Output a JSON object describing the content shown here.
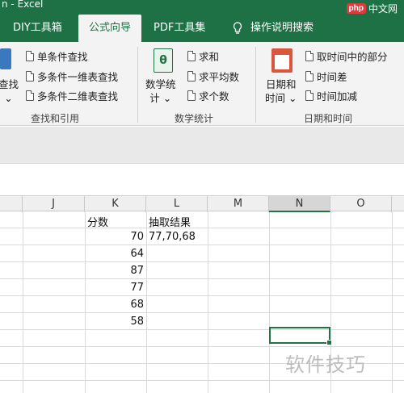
{
  "window": {
    "title_fragment": "n - Excel"
  },
  "brand": {
    "badge": "php",
    "text": "中文网"
  },
  "tabs": [
    {
      "label": "DIY工具箱"
    },
    {
      "label": "公式向导"
    },
    {
      "label": "PDF工具集"
    },
    {
      "label": "操作说明搜索"
    }
  ],
  "ribbon": {
    "group1": {
      "big_label": "查找",
      "items": [
        "单条件查找",
        "多条件一维表查找",
        "多条件二维表查找"
      ],
      "label": "查找和引用"
    },
    "group2": {
      "big_label_line1": "数学统",
      "big_label_line2": "计",
      "items": [
        "求和",
        "求平均数",
        "求个数"
      ],
      "label": "数学统计"
    },
    "group3": {
      "big_label_line1": "日期和",
      "big_label_line2": "时间",
      "items": [
        "取时间中的部分",
        "时间差",
        "时间加减"
      ],
      "label": "日期和时间"
    }
  },
  "sheet": {
    "columns": [
      "J",
      "K",
      "L",
      "M",
      "N",
      "O"
    ],
    "selected_column": "N",
    "header_k": "分数",
    "header_l": "抽取结果",
    "scores": [
      "70",
      "64",
      "87",
      "77",
      "68",
      "58"
    ],
    "result": "77,70,68"
  },
  "watermark": "软件技巧",
  "colors": {
    "excel_green": "#1e7145",
    "ribbon_bg": "#f3f3f3",
    "badge_red": "#e4393c"
  }
}
